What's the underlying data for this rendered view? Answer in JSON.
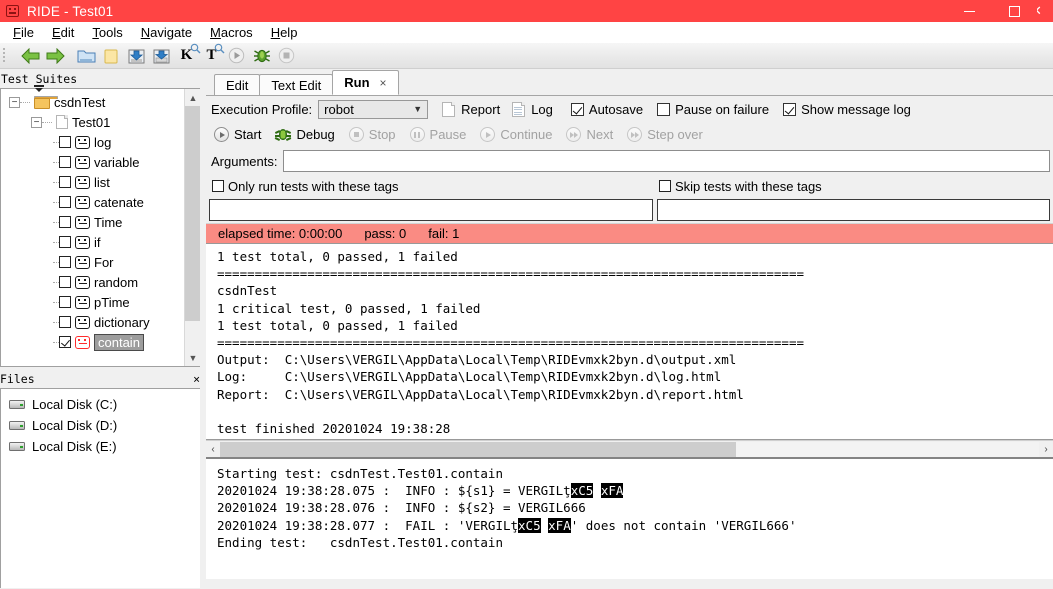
{
  "window": {
    "title": "RIDE - Test01",
    "icon": "ride-app-icon",
    "titlebar_color": "#ff4444",
    "buttons": {
      "minimize": "minimize-button",
      "maximize": "maximize-button",
      "close": "close-button"
    }
  },
  "menubar": {
    "items": [
      {
        "label": "File",
        "mnemonic": "F"
      },
      {
        "label": "Edit",
        "mnemonic": "E"
      },
      {
        "label": "Tools",
        "mnemonic": "T"
      },
      {
        "label": "Navigate",
        "mnemonic": "N"
      },
      {
        "label": "Macros",
        "mnemonic": "M"
      },
      {
        "label": "Help",
        "mnemonic": "H"
      }
    ]
  },
  "toolbar": {
    "items": [
      {
        "name": "back-arrow-icon",
        "glyph": "left-arrow-green"
      },
      {
        "name": "forward-arrow-icon",
        "glyph": "right-arrow-green"
      },
      {
        "name": "open-folder-icon",
        "glyph": "folder-blue"
      },
      {
        "name": "new-folder-icon",
        "glyph": "folder-yellow"
      },
      {
        "name": "save-icon",
        "glyph": "save-blue"
      },
      {
        "name": "save-all-icon",
        "glyph": "save-all-blue"
      },
      {
        "name": "search-keyword-icon",
        "glyph": "K"
      },
      {
        "name": "search-tests-icon",
        "glyph": "T"
      },
      {
        "name": "run-icon",
        "glyph": "play-circle"
      },
      {
        "name": "debug-icon",
        "glyph": "bug-green"
      },
      {
        "name": "stop-icon",
        "glyph": "stop-circle"
      }
    ]
  },
  "test_suites": {
    "panel_title": "Test Suites",
    "close_label": "×",
    "tree": [
      {
        "label": "csdnTest",
        "type": "folder",
        "depth": 0,
        "expanded": true,
        "checkbox": null,
        "selected": false
      },
      {
        "label": "Test01",
        "type": "file",
        "depth": 1,
        "expanded": true,
        "checkbox": null,
        "selected": false
      },
      {
        "label": "log",
        "type": "test",
        "depth": 2,
        "checkbox": false,
        "selected": false
      },
      {
        "label": "variable",
        "type": "test",
        "depth": 2,
        "checkbox": false,
        "selected": false
      },
      {
        "label": "list",
        "type": "test",
        "depth": 2,
        "checkbox": false,
        "selected": false
      },
      {
        "label": "catenate",
        "type": "test",
        "depth": 2,
        "checkbox": false,
        "selected": false
      },
      {
        "label": "Time",
        "type": "test",
        "depth": 2,
        "checkbox": false,
        "selected": false
      },
      {
        "label": "if",
        "type": "test",
        "depth": 2,
        "checkbox": false,
        "selected": false
      },
      {
        "label": "For",
        "type": "test",
        "depth": 2,
        "checkbox": false,
        "selected": false
      },
      {
        "label": "random",
        "type": "test",
        "depth": 2,
        "checkbox": false,
        "selected": false
      },
      {
        "label": "pTime",
        "type": "test",
        "depth": 2,
        "checkbox": false,
        "selected": false
      },
      {
        "label": "dictionary",
        "type": "test",
        "depth": 2,
        "checkbox": false,
        "selected": false
      },
      {
        "label": "contain",
        "type": "test-failed",
        "depth": 2,
        "checkbox": true,
        "selected": true
      }
    ]
  },
  "files": {
    "panel_title": "Files",
    "close_label": "×",
    "drives": [
      {
        "label": "Local Disk (C:)"
      },
      {
        "label": "Local Disk (D:)"
      },
      {
        "label": "Local Disk (E:)"
      }
    ]
  },
  "tabs": [
    {
      "label": "Edit",
      "active": false,
      "closable": false
    },
    {
      "label": "Text Edit",
      "active": false,
      "closable": false
    },
    {
      "label": "Run",
      "active": true,
      "closable": true,
      "close_label": "×"
    }
  ],
  "run_panel": {
    "execution_profile_label": "Execution Profile:",
    "execution_profile_value": "robot",
    "execution_profile_options": [
      "robot"
    ],
    "report_label": "Report",
    "log_label": "Log",
    "checkboxes": [
      {
        "label": "Autosave",
        "checked": true
      },
      {
        "label": "Pause on failure",
        "checked": false
      },
      {
        "label": "Show message log",
        "checked": true
      }
    ],
    "buttons": [
      {
        "label": "Start",
        "enabled": true,
        "icon": "play-icon"
      },
      {
        "label": "Debug",
        "enabled": true,
        "icon": "bug-icon"
      },
      {
        "label": "Stop",
        "enabled": false,
        "icon": "stop-icon"
      },
      {
        "label": "Pause",
        "enabled": false,
        "icon": "pause-icon"
      },
      {
        "label": "Continue",
        "enabled": false,
        "icon": "play-icon"
      },
      {
        "label": "Next",
        "enabled": false,
        "icon": "next-icon"
      },
      {
        "label": "Step over",
        "enabled": false,
        "icon": "step-over-icon"
      }
    ],
    "arguments_label": "Arguments:",
    "arguments_value": "",
    "only_run_tags_label": "Only run tests with these tags",
    "only_run_tags_checked": false,
    "only_run_tags_value": "",
    "skip_tags_label": "Skip tests with these tags",
    "skip_tags_checked": false,
    "skip_tags_value": "",
    "status_bar": {
      "elapsed_label": "elapsed time: 0:00:00",
      "pass_label": "pass: 0",
      "fail_label": "fail: 1",
      "color": "#fa8b83"
    },
    "console_output": "1 test total, 0 passed, 1 failed\n==============================================================================\ncsdnTest\n1 critical test, 0 passed, 1 failed\n1 test total, 0 passed, 1 failed\n==============================================================================\nOutput:  C:\\Users\\VERGIL\\AppData\\Local\\Temp\\RIDEvmxk2byn.d\\output.xml\nLog:     C:\\Users\\VERGIL\\AppData\\Local\\Temp\\RIDEvmxk2byn.d\\log.html\nReport:  C:\\Users\\VERGIL\\AppData\\Local\\Temp\\RIDEvmxk2byn.d\\report.html\n\ntest finished 20201024 19:38:28",
    "hscroll": {
      "left_arrow": "‹",
      "right_arrow": "›",
      "thumb_percent": 63
    },
    "message_log": [
      {
        "pre": "Starting test: csdnTest.Test01.contain",
        "inv": null,
        "post": ""
      },
      {
        "pre": "20201024 19:38:28.075 :  INFO : ${s1} = VERGILţ",
        "inv": "xC5 xFA",
        "post": ""
      },
      {
        "pre": "20201024 19:38:28.076 :  INFO : ${s2} = VERGIL666",
        "inv": null,
        "post": ""
      },
      {
        "pre": "20201024 19:38:28.077 :  FAIL : 'VERGILţ",
        "inv": "xC5 xFA",
        "post": "' does not contain 'VERGIL666'"
      },
      {
        "pre": "Ending test:   csdnTest.Test01.contain",
        "inv": null,
        "post": ""
      }
    ]
  }
}
